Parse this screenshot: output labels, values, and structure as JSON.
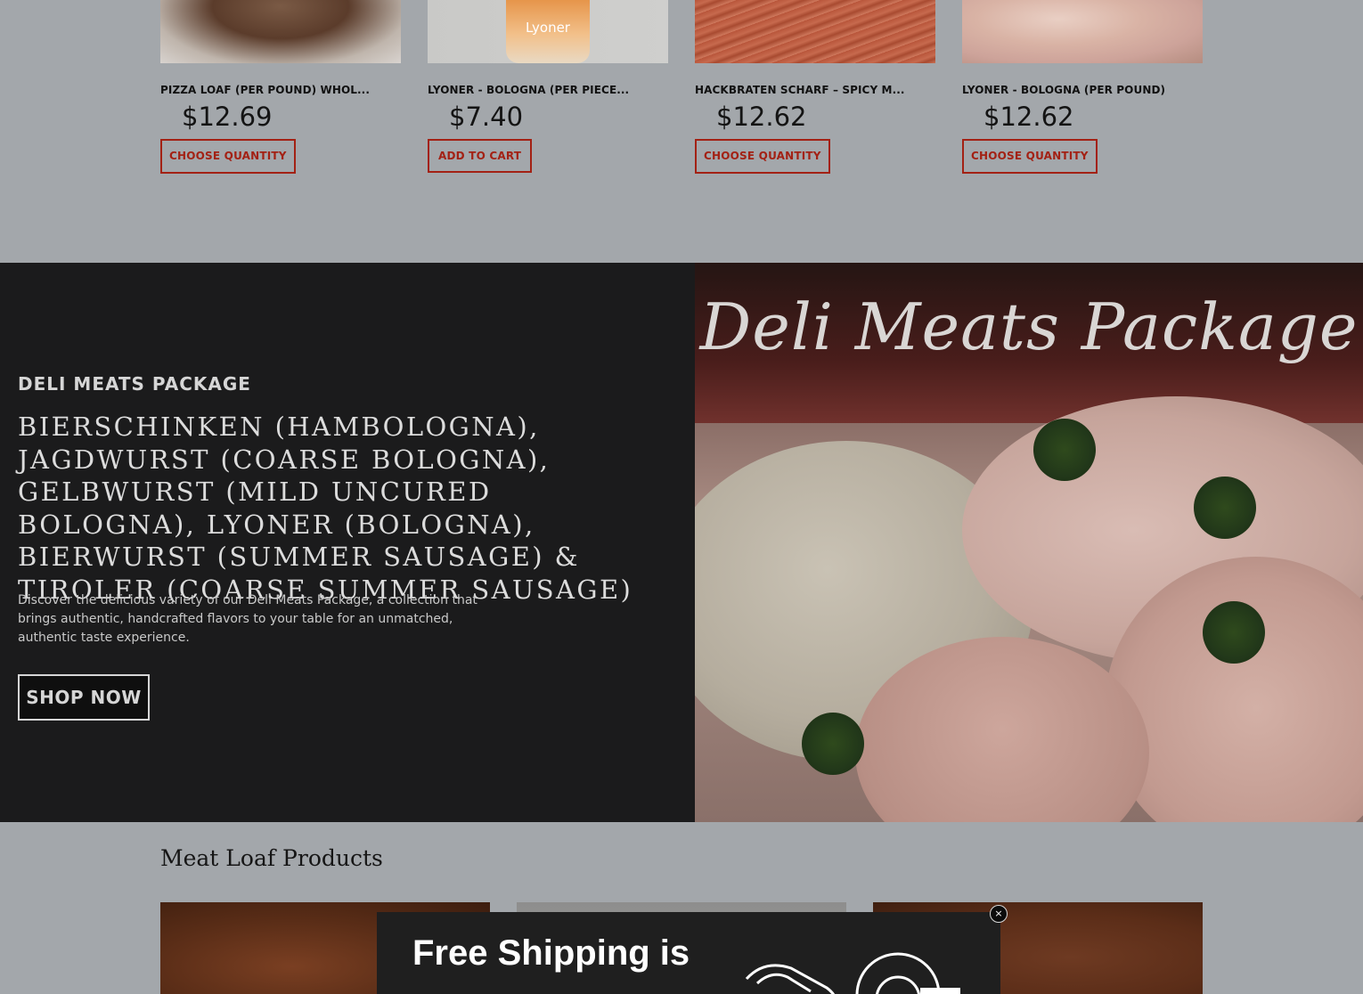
{
  "top_products": [
    {
      "name": "PIZZA LOAF (PER POUND) WHOL...",
      "price": "$12.69",
      "button": "CHOOSE QUANTITY"
    },
    {
      "name": "LYONER - BOLOGNA (PER PIECE...",
      "price": "$7.40",
      "button": "ADD TO CART",
      "image_label": "Lyoner"
    },
    {
      "name": "HACKBRATEN SCHARF – SPICY M...",
      "price": "$12.62",
      "button": "CHOOSE QUANTITY"
    },
    {
      "name": "LYONER - BOLOGNA (PER POUND)",
      "price": "$12.62",
      "button": "CHOOSE QUANTITY"
    }
  ],
  "promo": {
    "eyebrow": "DELI MEATS PACKAGE",
    "title": "BIERSCHINKEN (HAMBOLOGNA), JAGDWURST (COARSE BOLOGNA), GELBWURST (MILD UNCURED BOLOGNA), LYONER (BOLOGNA), BIERWURST (SUMMER SAUSAGE) & TIROLER (COARSE SUMMER SAUSAGE)",
    "description": "Discover the delicious variety of our Deli Meats Package, a collection that brings authentic, handcrafted flavors to your table for an unmatched, authentic taste experience.",
    "cta": "SHOP NOW",
    "image_title": "Deli Meats Package"
  },
  "meat_loaf_section": {
    "title": "Meat Loaf Products"
  },
  "popup": {
    "title": "Free Shipping is",
    "close_label": "×"
  }
}
